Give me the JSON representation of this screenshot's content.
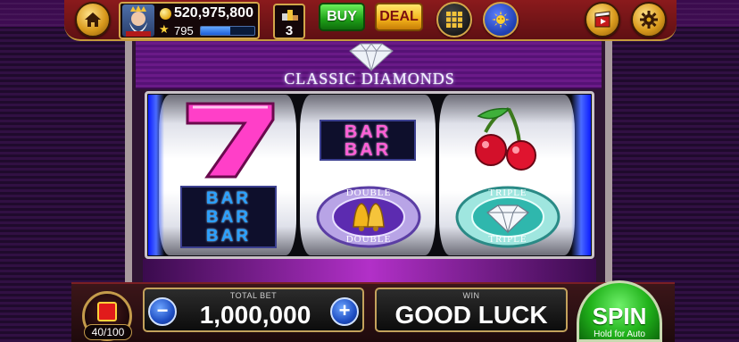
{
  "game": {
    "title": "CLASSIC DIAMONDS"
  },
  "player": {
    "balance": "520,975,800",
    "level": "795",
    "xp_progress": 0.55,
    "rank": "3"
  },
  "topbar": {
    "buy_label": "BUY",
    "deal_label": "DEAL"
  },
  "reels": {
    "bar_text": "BAR",
    "double_badge": {
      "top": "DOUBLE",
      "bottom": "DOUBLE"
    },
    "triple_badge": {
      "top": "TRIPLE",
      "bottom": "TRIPLE"
    }
  },
  "bottom": {
    "chest_progress": "40/100",
    "total_bet_label": "TOTAL BET",
    "total_bet": "1,000,000",
    "minus_label": "−",
    "plus_label": "+",
    "win_label": "WIN",
    "win_text": "GOOD LUCK",
    "spin_label": "SPIN",
    "spin_sub": "Hold for Auto"
  },
  "colors": {
    "accent_gold": "#d3a64a",
    "spin_green": "#21b31b",
    "bar_pink": "#ff5fd6",
    "bar_blue": "#2aa0ff"
  },
  "icons": [
    "home-icon",
    "coin-icon",
    "star-icon",
    "rank-icon",
    "grid-icon",
    "sun-icon",
    "film-icon",
    "gear-icon",
    "gift-icon"
  ]
}
